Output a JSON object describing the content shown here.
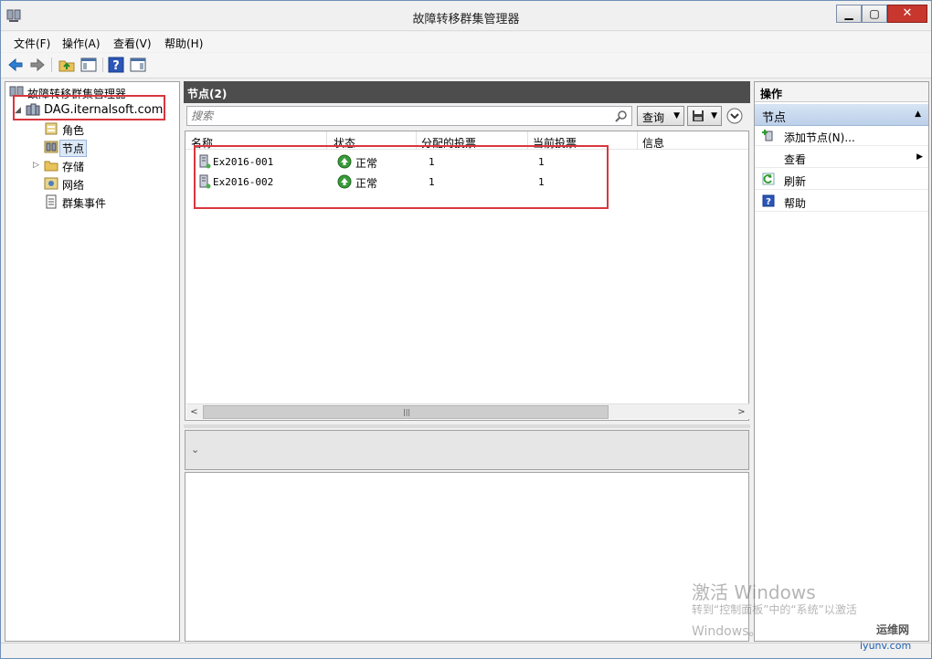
{
  "window": {
    "title": "故障转移群集管理器",
    "controls": {
      "minimize": "▁",
      "maximize": "▢",
      "close": "✕"
    }
  },
  "menu": [
    "文件(F)",
    "操作(A)",
    "查看(V)",
    "帮助(H)"
  ],
  "tree": {
    "root": "故障转移群集管理器",
    "cluster": "DAG.iternalsoft.com",
    "children": [
      "角色",
      "节点",
      "存储",
      "网络",
      "群集事件"
    ],
    "selected": "节点"
  },
  "center": {
    "header": "节点(2)",
    "search_placeholder": "搜索",
    "query_label": "查询",
    "columns": [
      "名称",
      "状态",
      "分配的投票",
      "当前投票",
      "信息"
    ],
    "rows": [
      {
        "name": "Ex2016-001",
        "status": "正常",
        "assigned_vote": "1",
        "current_vote": "1"
      },
      {
        "name": "Ex2016-002",
        "status": "正常",
        "assigned_vote": "1",
        "current_vote": "1"
      }
    ]
  },
  "actions": {
    "header": "操作",
    "section": "节点",
    "items": [
      {
        "label": "添加节点(N)...",
        "icon": "add-node-icon"
      },
      {
        "label": "查看",
        "icon": "none",
        "submenu": true
      },
      {
        "label": "刷新",
        "icon": "refresh-icon"
      },
      {
        "label": "帮助",
        "icon": "help-icon"
      }
    ]
  },
  "watermark": {
    "line1": "激活 Windows",
    "line2": "转到“控制面板”中的“系统”以激活",
    "line3": "Windows。",
    "logo": "运维网",
    "domain": "iyunv.com"
  },
  "colors": {
    "annotation": "#d9363e",
    "header_dark": "#4d4d4d",
    "status_ok": "#3a9a3a"
  }
}
